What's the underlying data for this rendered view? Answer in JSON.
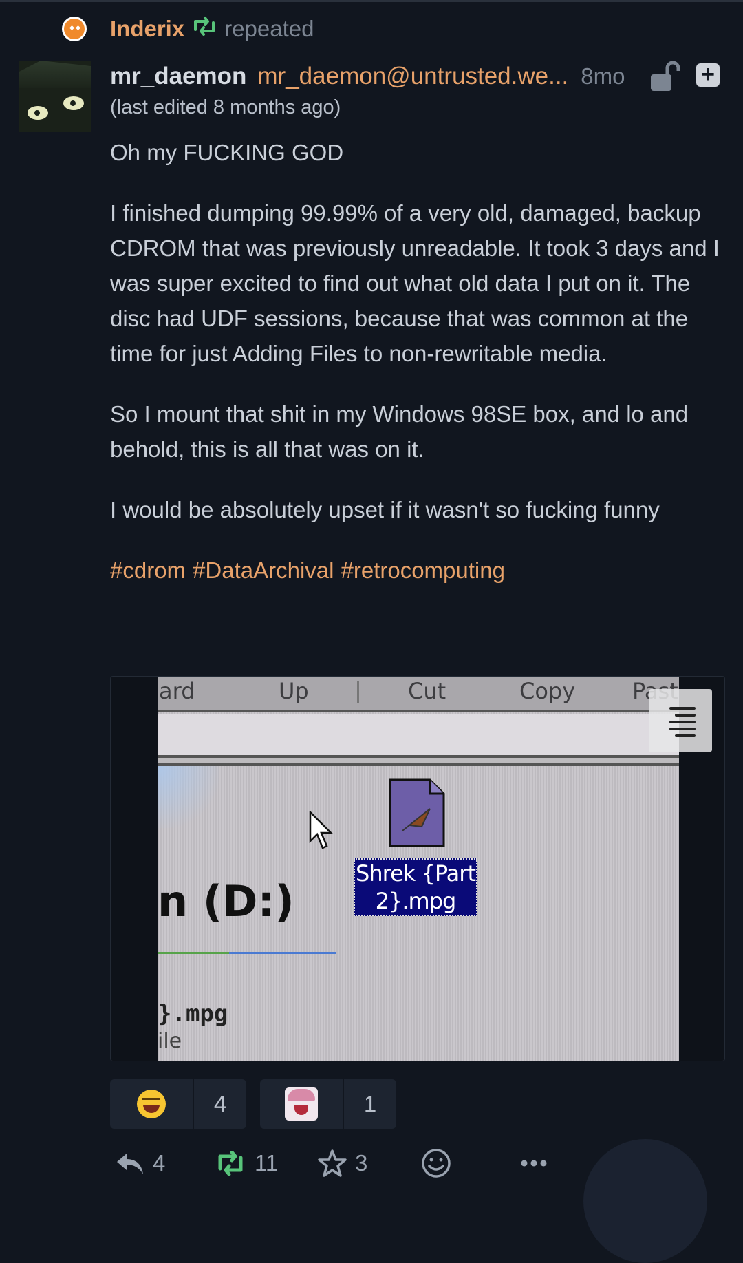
{
  "repeat": {
    "repeater_name": "Inderix",
    "label": "repeated"
  },
  "post": {
    "display_name": "mr_daemon",
    "handle": "mr_daemon@untrusted.we...",
    "time": "8mo",
    "edited": "(last edited 8 months ago)",
    "paragraphs": [
      "Oh my FUCKING GOD",
      "I finished dumping 99.99% of a very old, damaged, backup CDROM that was previously unreadable. It took 3 days and I was super excited to find out what old data I put on it. The disc had UDF sessions, because that was common at the time for just Adding Files to non-rewritable media.",
      "So I mount that shit in my Windows 98SE box, and lo and behold, this is all that was on it.",
      "I would be absolutely upset if it wasn't so fucking funny"
    ],
    "hashtags": [
      "#cdrom",
      "#DataArchival",
      "#retrocomputing"
    ]
  },
  "attachment": {
    "toolbar": [
      "ard",
      "Up",
      "Cut",
      "Copy",
      "Past"
    ],
    "file_label": "Shrek {Part 2}.mpg",
    "drive": "n (D:)",
    "file_name": "}.mpg",
    "file_type": "ile"
  },
  "reactions": [
    {
      "emoji": "laughing-emoji",
      "count": "4"
    },
    {
      "emoji": "custom-anime-emoji",
      "count": "1"
    }
  ],
  "actions": {
    "replies": "4",
    "boosts": "11",
    "favourites": "3"
  },
  "colors": {
    "background": "#11161f",
    "accent": "#e8a26a",
    "boost_green": "#58c47a"
  }
}
